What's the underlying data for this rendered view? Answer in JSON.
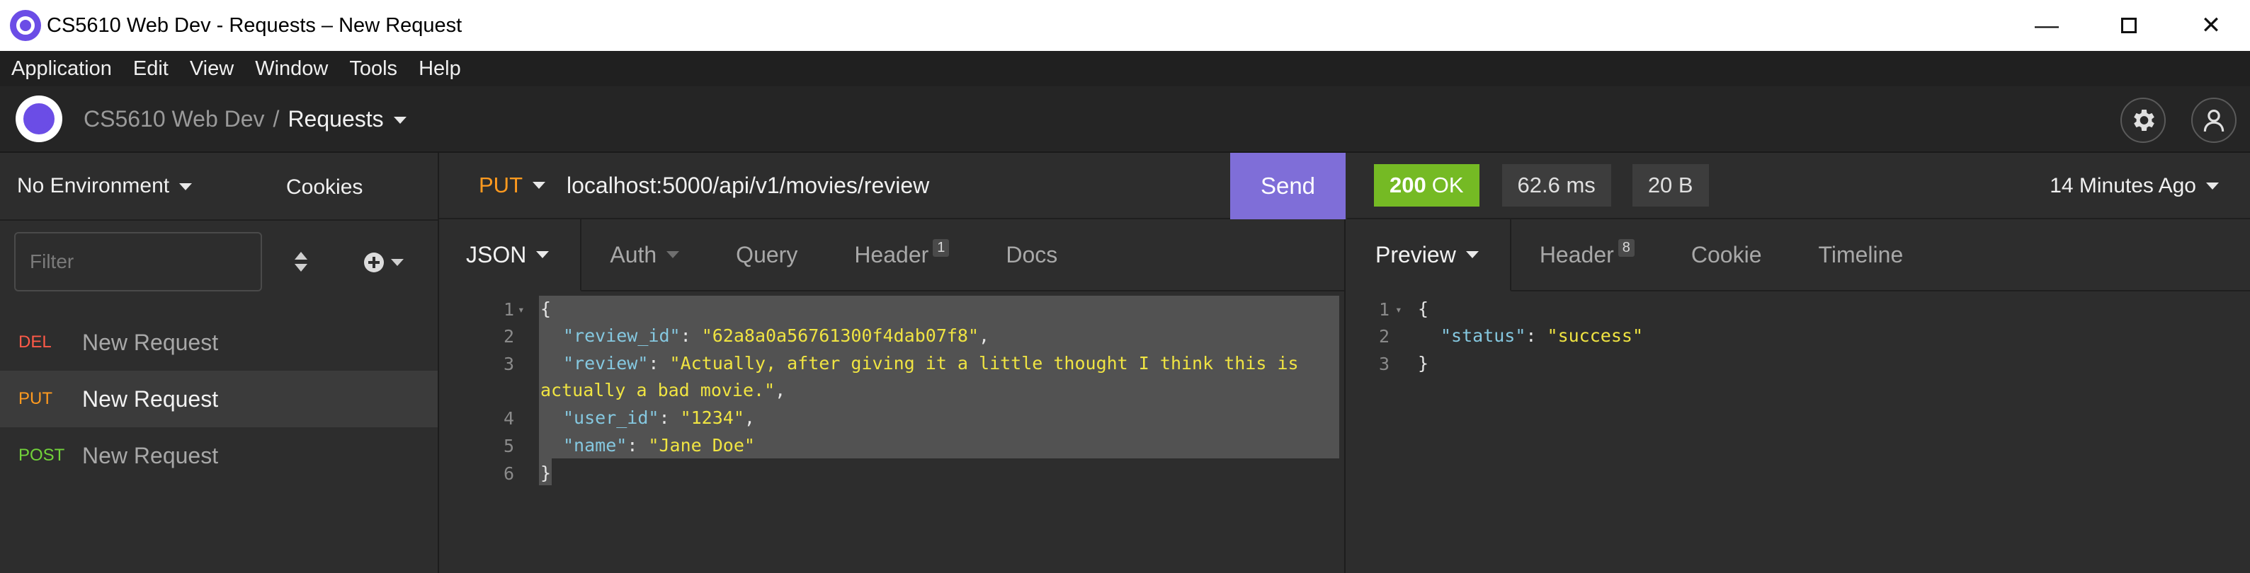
{
  "window": {
    "title": "CS5610 Web Dev - Requests – New Request",
    "minimize": "—",
    "close": "✕"
  },
  "menu": [
    "Application",
    "Edit",
    "View",
    "Window",
    "Tools",
    "Help"
  ],
  "header": {
    "workspace": "CS5610 Web Dev",
    "separator": "/",
    "collection": "Requests"
  },
  "sidebar": {
    "environment": "No Environment",
    "cookies": "Cookies",
    "filter_placeholder": "Filter",
    "requests": [
      {
        "method": "DEL",
        "name": "New Request",
        "color": "#ff5a48"
      },
      {
        "method": "PUT",
        "name": "New Request",
        "color": "#ff9a1f"
      },
      {
        "method": "POST",
        "name": "New Request",
        "color": "#72d33a"
      }
    ]
  },
  "request": {
    "method": "PUT",
    "method_color": "#ff9a1f",
    "url": "localhost:5000/api/v1/movies/review",
    "send_label": "Send",
    "tabs": [
      {
        "label": "JSON",
        "badge": ""
      },
      {
        "label": "Auth",
        "badge": ""
      },
      {
        "label": "Query",
        "badge": ""
      },
      {
        "label": "Header",
        "badge": "1"
      },
      {
        "label": "Docs",
        "badge": ""
      }
    ],
    "body_lines": [
      {
        "num": "1",
        "text": "{"
      },
      {
        "num": "2",
        "key": "\"review_id\"",
        "value": "\"62a8a0a56761300f4dab07f8\"",
        "tail": ","
      },
      {
        "num": "3",
        "key": "\"review\"",
        "value": "\"Actually, after giving it a little thought I think this is",
        "cont": "actually a bad movie.\"",
        "tail": ","
      },
      {
        "num": "4",
        "key": "\"user_id\"",
        "value": "\"1234\"",
        "tail": ","
      },
      {
        "num": "5",
        "key": "\"name\"",
        "value": "\"Jane Doe\"",
        "tail": ""
      },
      {
        "num": "6",
        "text": "}"
      }
    ]
  },
  "response": {
    "status_code": "200",
    "status_text": "OK",
    "time": "62.6 ms",
    "size": "20 B",
    "age": "14 Minutes Ago",
    "tabs": [
      {
        "label": "Preview",
        "badge": ""
      },
      {
        "label": "Header",
        "badge": "8"
      },
      {
        "label": "Cookie",
        "badge": ""
      },
      {
        "label": "Timeline",
        "badge": ""
      }
    ],
    "body_lines": [
      {
        "num": "1",
        "text": "{"
      },
      {
        "num": "2",
        "key": "\"status\"",
        "value": "\"success\""
      },
      {
        "num": "3",
        "text": "}"
      }
    ]
  },
  "colors": {
    "accent": "#7f6ed8",
    "status_ok": "#75ba24",
    "json_key": "#85c8e0",
    "json_string": "#f0e442"
  }
}
